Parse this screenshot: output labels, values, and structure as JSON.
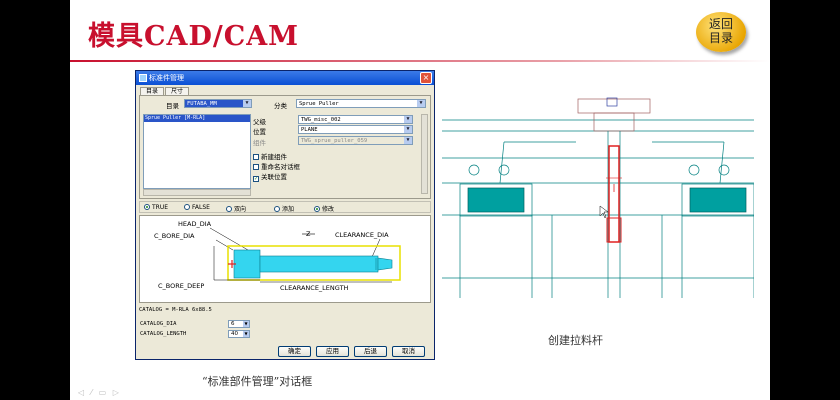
{
  "slide": {
    "title": "模具CAD/CAM",
    "back_button": {
      "line1": "返回",
      "line2": "目录"
    },
    "caption_left": "“标准部件管理”对话框",
    "caption_right": "创建拉料杆",
    "nav_icons": [
      "arrow-left-icon",
      "pen-icon",
      "menu-icon",
      "arrow-right-icon"
    ]
  },
  "dialog": {
    "title": "标准件管理",
    "tabs": [
      "目录",
      "尺寸"
    ],
    "catalog_label": "目录",
    "catalog_value": "FUTABA_MM",
    "class_label": "分类",
    "class_value": "Sprue Puller",
    "list_items": [
      "Sprue Puller [M-RLA]"
    ],
    "parent_label": "父级",
    "parent_value": "TWG_misc_002",
    "position_label": "位置",
    "position_value": "PLANE",
    "component_label": "组件",
    "component_value": "TWG_sprue_puller_059",
    "checkboxes": [
      {
        "label": "新建组件",
        "checked": false
      },
      {
        "label": "重命名对话框",
        "checked": false
      },
      {
        "label": "关联位置",
        "checked": true
      }
    ],
    "radios_left": [
      {
        "label": "TRUE",
        "selected": true
      },
      {
        "label": "FALSE",
        "selected": false
      },
      {
        "label": "双向",
        "selected": false
      }
    ],
    "radios_right": [
      {
        "label": "添加",
        "selected": false
      },
      {
        "label": "修改",
        "selected": true
      }
    ],
    "diagram": {
      "head_dia": "HEAD_DIA",
      "c_bore_dia": "C_BORE_DIA",
      "clearance_dia": "CLEARANCE_DIA",
      "c_bore_deep": "C_BORE_DEEP",
      "clearance_length": "CLEARANCE_LENGTH",
      "axis_label": "Z"
    },
    "catalog_line": "CATALOG = M-RLA 6x88.5",
    "params": [
      {
        "label": "CATALOG_DIA",
        "value": "6"
      },
      {
        "label": "CATALOG_LENGTH",
        "value": "40"
      }
    ],
    "buttons": [
      "确定",
      "应用",
      "后退",
      "取消"
    ]
  },
  "colors": {
    "title_red": "#c8102e",
    "cad_cyan": "#008080",
    "cad_red": "#e02020",
    "dialog_bg": "#ece9d8",
    "titlebar_blue": "#0a4fd4"
  }
}
